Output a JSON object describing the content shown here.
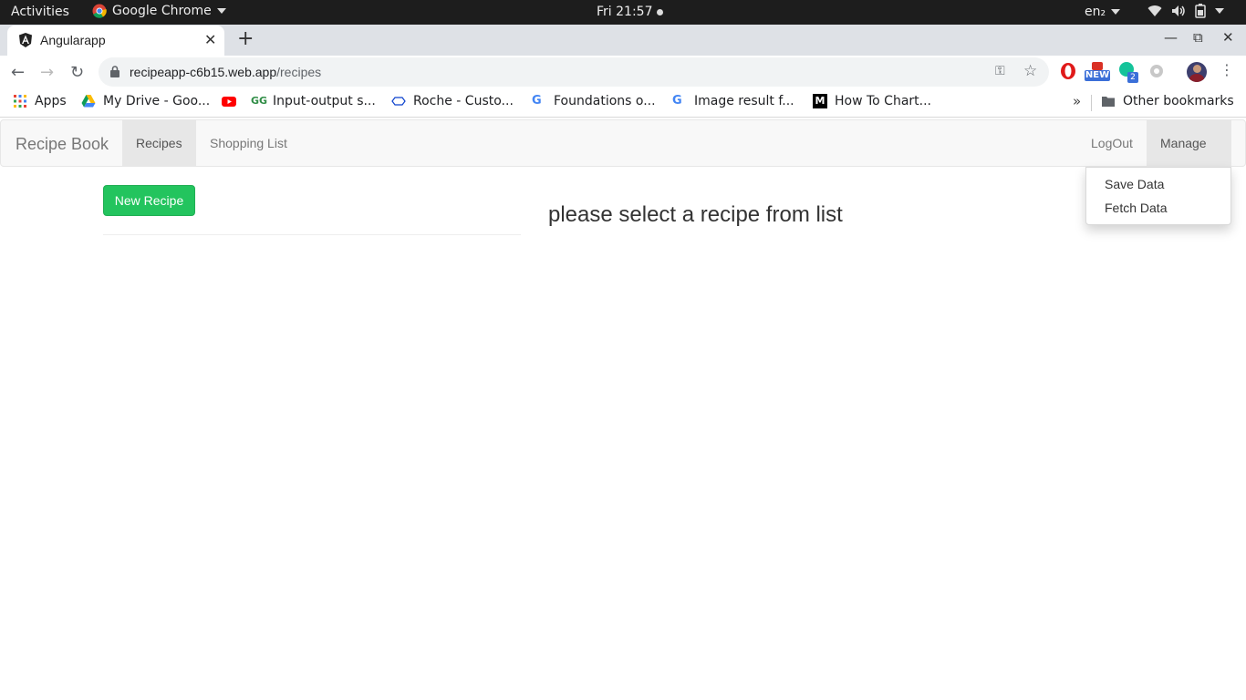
{
  "system_bar": {
    "activities": "Activities",
    "app_name": "Google Chrome",
    "clock": "Fri 21:57",
    "language": "en₂"
  },
  "browser": {
    "tab_title": "Angularapp",
    "url_host": "recipeapp-c6b15.web.app",
    "url_path": "/recipes",
    "extension_badge_new": "NEW",
    "extension_badge_count": "2",
    "bookmarks": [
      {
        "label": "Apps",
        "icon": "apps-grid-icon"
      },
      {
        "label": "My Drive - Goo...",
        "icon": "google-drive-icon"
      },
      {
        "label": "",
        "icon": "youtube-icon"
      },
      {
        "label": "Input-output s...",
        "icon": "geeksforgeeks-icon"
      },
      {
        "label": "Roche - Custo...",
        "icon": "roche-icon"
      },
      {
        "label": "Foundations o...",
        "icon": "google-icon"
      },
      {
        "label": "Image result f...",
        "icon": "google-icon"
      },
      {
        "label": "How To Chart...",
        "icon": "medium-icon"
      }
    ],
    "more_bookmarks": "»",
    "other_bookmarks": "Other bookmarks"
  },
  "app": {
    "brand": "Recipe Book",
    "nav": {
      "recipes": "Recipes",
      "shopping_list": "Shopping List",
      "logout": "LogOut",
      "manage": "Manage"
    },
    "manage_menu": [
      "Save Data",
      "Fetch Data"
    ],
    "new_recipe_button": "New Recipe",
    "detail_placeholder": "please select a recipe from list",
    "colors": {
      "success": "#23c45e",
      "navbar_bg": "#f8f8f8",
      "navbar_active": "#e7e7e7"
    }
  }
}
